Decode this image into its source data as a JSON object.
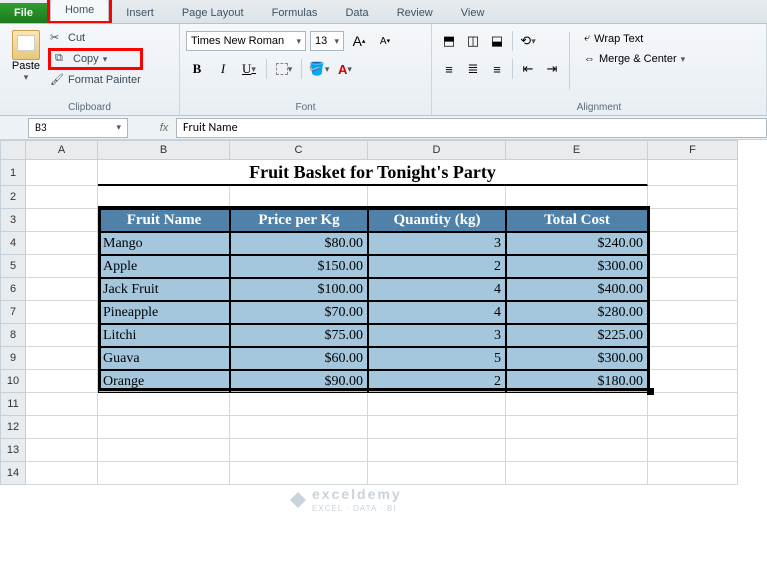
{
  "tabs": {
    "file": "File",
    "home": "Home",
    "insert": "Insert",
    "pageLayout": "Page Layout",
    "formulas": "Formulas",
    "data": "Data",
    "review": "Review",
    "view": "View"
  },
  "ribbon": {
    "clipboard": {
      "paste": "Paste",
      "cut": "Cut",
      "copy": "Copy",
      "formatPainter": "Format Painter",
      "group": "Clipboard"
    },
    "font": {
      "name": "Times New Roman",
      "size": "13",
      "group": "Font",
      "bold": "B",
      "italic": "I",
      "underline": "U",
      "increase": "A",
      "decrease": "A"
    },
    "alignment": {
      "group": "Alignment",
      "wrapText": "Wrap Text",
      "mergeCenter": "Merge & Center"
    }
  },
  "bar": {
    "nameBox": "B3",
    "formula": "Fruit Name"
  },
  "columns": [
    "A",
    "B",
    "C",
    "D",
    "E",
    "F"
  ],
  "rows": [
    "1",
    "2",
    "3",
    "4",
    "5",
    "6",
    "7",
    "8",
    "9",
    "10",
    "11",
    "12",
    "13",
    "14"
  ],
  "title": "Fruit Basket for Tonight's Party",
  "headers": {
    "b": "Fruit Name",
    "c": "Price per Kg",
    "d": "Quantity (kg)",
    "e": "Total Cost"
  },
  "data": [
    {
      "b": "Mango",
      "c": "$80.00",
      "d": "3",
      "e": "$240.00"
    },
    {
      "b": "Apple",
      "c": "$150.00",
      "d": "2",
      "e": "$300.00"
    },
    {
      "b": "Jack Fruit",
      "c": "$100.00",
      "d": "4",
      "e": "$400.00"
    },
    {
      "b": "Pineapple",
      "c": "$70.00",
      "d": "4",
      "e": "$280.00"
    },
    {
      "b": "Litchi",
      "c": "$75.00",
      "d": "3",
      "e": "$225.00"
    },
    {
      "b": "Guava",
      "c": "$60.00",
      "d": "5",
      "e": "$300.00"
    },
    {
      "b": "Orange",
      "c": "$90.00",
      "d": "2",
      "e": "$180.00"
    }
  ],
  "watermark": {
    "brand": "exceldemy",
    "tag": "EXCEL · DATA · BI"
  },
  "chart_data": {
    "type": "table",
    "title": "Fruit Basket for Tonight's Party",
    "columns": [
      "Fruit Name",
      "Price per Kg",
      "Quantity (kg)",
      "Total Cost"
    ],
    "rows": [
      [
        "Mango",
        80.0,
        3,
        240.0
      ],
      [
        "Apple",
        150.0,
        2,
        300.0
      ],
      [
        "Jack Fruit",
        100.0,
        4,
        400.0
      ],
      [
        "Pineapple",
        70.0,
        4,
        280.0
      ],
      [
        "Litchi",
        75.0,
        3,
        225.0
      ],
      [
        "Guava",
        60.0,
        5,
        300.0
      ],
      [
        "Orange",
        90.0,
        2,
        180.0
      ]
    ]
  }
}
